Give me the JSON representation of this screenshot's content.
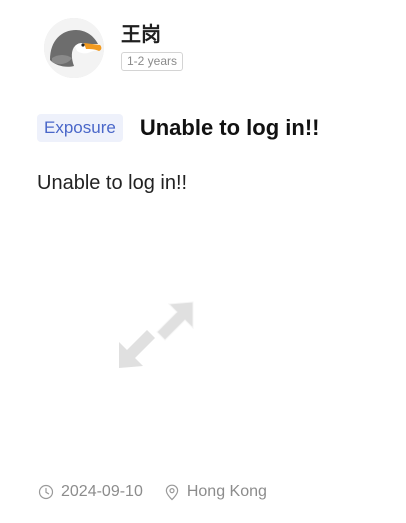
{
  "user": {
    "name": "王岗",
    "experience": "1-2 years"
  },
  "post": {
    "category": "Exposure",
    "title": "Unable to log in!!",
    "body": "Unable to log in!!"
  },
  "footer": {
    "date": "2024-09-10",
    "location": "Hong Kong"
  },
  "icons": {
    "avatar": "eagle-avatar",
    "image_placeholder": "expand-arrows-icon",
    "date": "clock-icon",
    "location": "location-pin-icon"
  },
  "colors": {
    "tag_background": "#eef1fb",
    "tag_text": "#4a67c9",
    "meta_text": "#8c8c8c"
  }
}
